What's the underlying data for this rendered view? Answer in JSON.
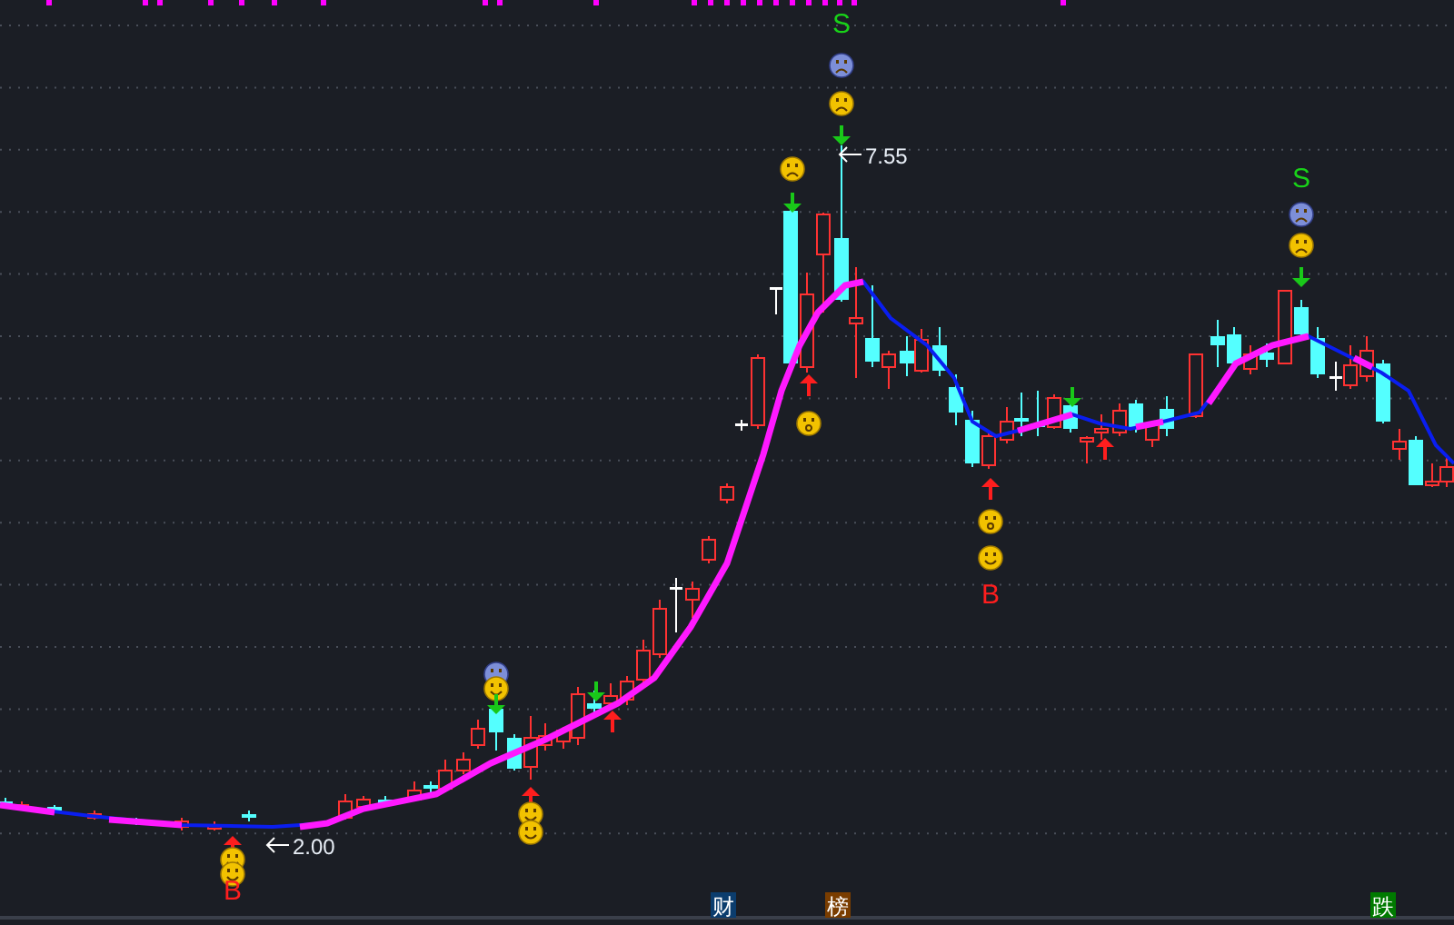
{
  "signals": [
    {
      "label": "S",
      "kind": "sell"
    },
    {
      "label": "S",
      "kind": "sell"
    },
    {
      "label": "B",
      "kind": "buy"
    },
    {
      "label": "B",
      "kind": "buy"
    }
  ],
  "price_labels": [
    "7.55",
    "2.00"
  ],
  "tags": [
    {
      "label": "财",
      "color": "#0b3d6e"
    },
    {
      "label": "榜",
      "color": "#7a3d00"
    },
    {
      "label": "跌",
      "color": "#007a00"
    }
  ]
}
